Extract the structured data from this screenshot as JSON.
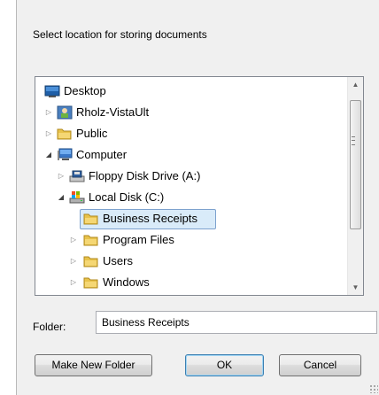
{
  "dialog": {
    "prompt": "Select location for storing documents",
    "folder_label": "Folder:",
    "folder_value": "Business Receipts",
    "buttons": {
      "make_new_folder": "Make New Folder",
      "ok": "OK",
      "cancel": "Cancel"
    }
  },
  "tree": {
    "nodes": [
      {
        "label": "Desktop",
        "icon": "desktop-icon",
        "expander": "none"
      },
      {
        "label": "Rholz-VistaUlt",
        "icon": "user-folder-icon",
        "expander": "collapsed"
      },
      {
        "label": "Public",
        "icon": "folder-icon",
        "expander": "collapsed"
      },
      {
        "label": "Computer",
        "icon": "computer-icon",
        "expander": "expanded"
      },
      {
        "label": "Floppy Disk Drive (A:)",
        "icon": "floppy-drive-icon",
        "expander": "collapsed"
      },
      {
        "label": "Local Disk (C:)",
        "icon": "hard-disk-icon",
        "expander": "expanded"
      },
      {
        "label": "Business Receipts",
        "icon": "folder-icon",
        "expander": "none",
        "selected": true
      },
      {
        "label": "Program Files",
        "icon": "folder-icon",
        "expander": "collapsed"
      },
      {
        "label": "Users",
        "icon": "folder-icon",
        "expander": "collapsed"
      },
      {
        "label": "Windows",
        "icon": "folder-icon",
        "expander": "collapsed"
      }
    ]
  },
  "colors": {
    "dialog_bg": "#f0f0f0",
    "selection_bg": "#d9ebf9",
    "selection_border": "#7da2ce",
    "folder_yellow": "#e8c24a"
  }
}
